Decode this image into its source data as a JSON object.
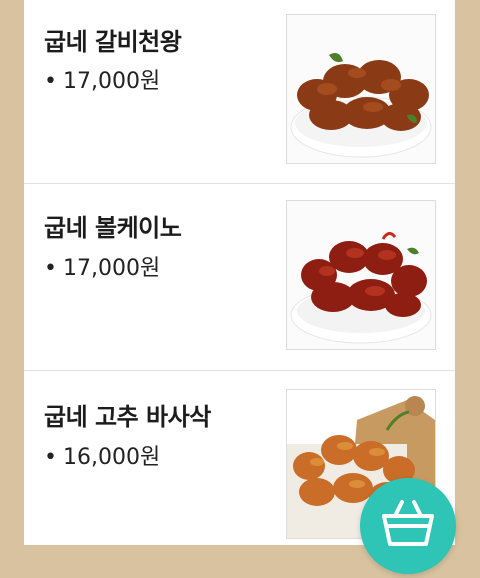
{
  "menu": {
    "items": [
      {
        "name": "굽네 갈비천왕",
        "price": "17,000원"
      },
      {
        "name": "굽네 볼케이노",
        "price": "17,000원"
      },
      {
        "name": "굽네 고추 바사삭",
        "price": "16,000원"
      }
    ],
    "bullet": "•"
  },
  "colors": {
    "frame": "#d8c29f",
    "accent": "#2ec4b6",
    "divider": "#e2e2e2"
  },
  "icons": {
    "cart": "shopping-basket-icon"
  }
}
